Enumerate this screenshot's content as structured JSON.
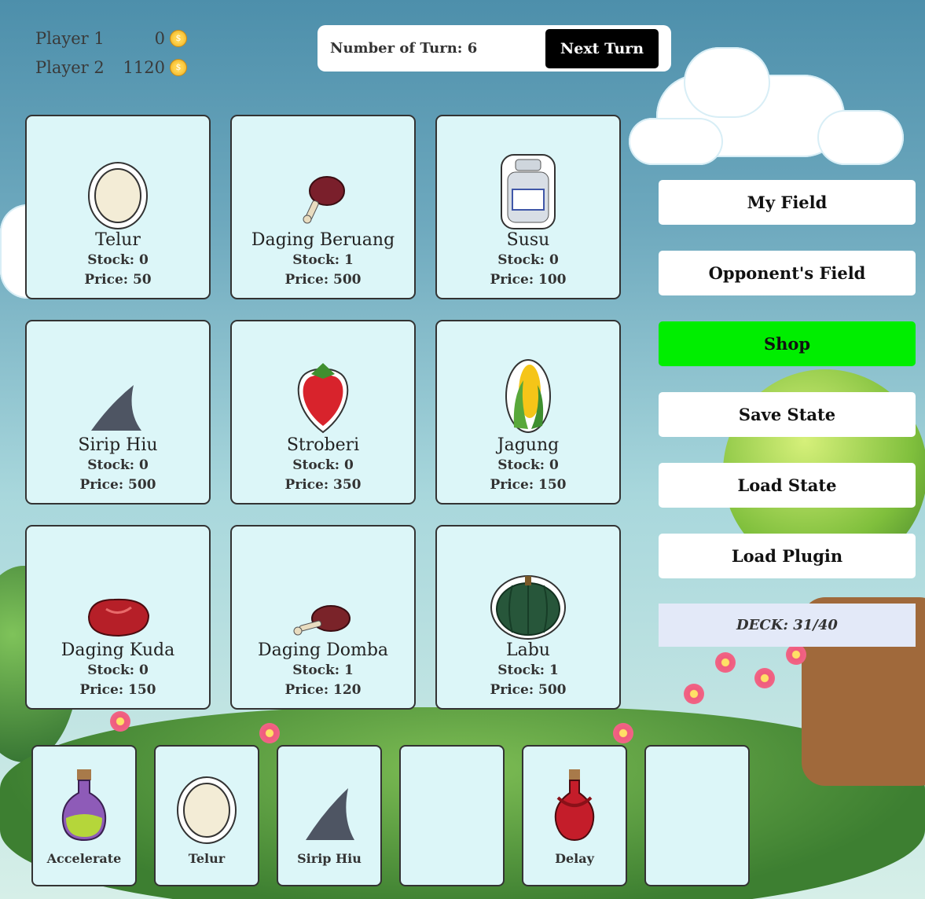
{
  "players": [
    {
      "name": "Player 1",
      "money": "0"
    },
    {
      "name": "Player 2",
      "money": "1120"
    }
  ],
  "turn": {
    "label": "Number of Turn: 6",
    "next_label": "Next Turn"
  },
  "shop_items": [
    {
      "name": "Telur",
      "stock": "Stock: 0",
      "price": "Price: 50",
      "icon": "egg-icon"
    },
    {
      "name": "Daging Beruang",
      "stock": "Stock: 1",
      "price": "Price: 500",
      "icon": "bear-meat-icon"
    },
    {
      "name": "Susu",
      "stock": "Stock: 0",
      "price": "Price: 100",
      "icon": "milk-can-icon"
    },
    {
      "name": "Sirip Hiu",
      "stock": "Stock: 0",
      "price": "Price: 500",
      "icon": "shark-fin-icon"
    },
    {
      "name": "Stroberi",
      "stock": "Stock: 0",
      "price": "Price: 350",
      "icon": "strawberry-icon"
    },
    {
      "name": "Jagung",
      "stock": "Stock: 0",
      "price": "Price: 150",
      "icon": "corn-icon"
    },
    {
      "name": "Daging Kuda",
      "stock": "Stock: 0",
      "price": "Price: 150",
      "icon": "horse-meat-icon"
    },
    {
      "name": "Daging Domba",
      "stock": "Stock: 1",
      "price": "Price: 120",
      "icon": "lamb-meat-icon"
    },
    {
      "name": "Labu",
      "stock": "Stock: 1",
      "price": "Price: 500",
      "icon": "pumpkin-icon"
    }
  ],
  "menu": {
    "my_field": "My Field",
    "opponent_field": "Opponent's Field",
    "shop": "Shop",
    "save_state": "Save State",
    "load_state": "Load State",
    "load_plugin": "Load Plugin",
    "active_color": "#00ee00"
  },
  "deck": {
    "label": "DECK: 31/40"
  },
  "hand": [
    {
      "label": "Accelerate",
      "icon": "accelerate-potion-icon"
    },
    {
      "label": "Telur",
      "icon": "egg-icon"
    },
    {
      "label": "Sirip Hiu",
      "icon": "shark-fin-icon"
    },
    {
      "label": "",
      "icon": ""
    },
    {
      "label": "Delay",
      "icon": "delay-potion-icon"
    },
    {
      "label": "",
      "icon": ""
    }
  ]
}
